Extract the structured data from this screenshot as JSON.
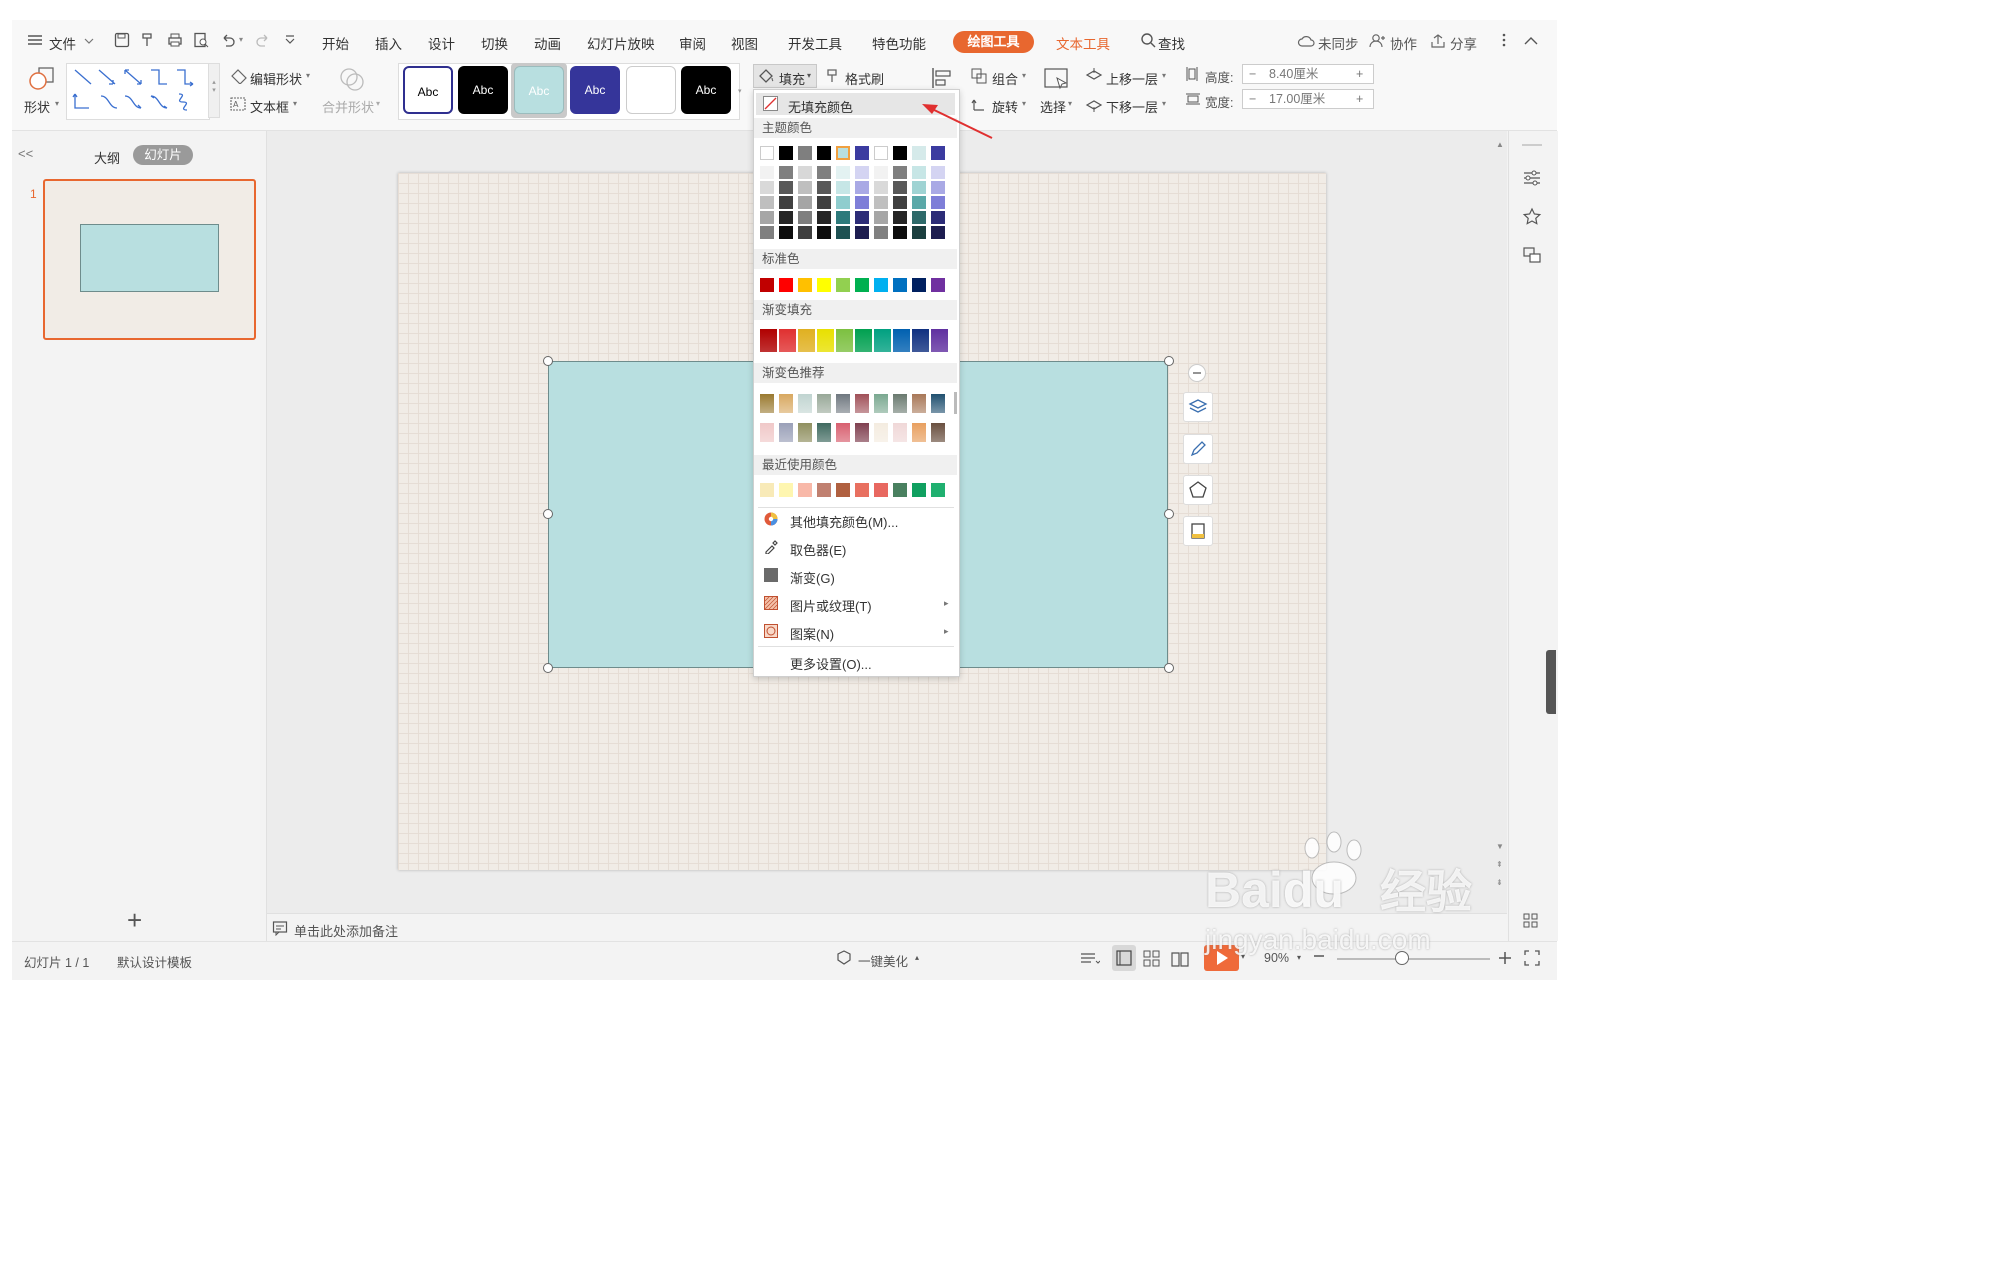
{
  "menubar": {
    "file_label": "文件",
    "tabs": [
      "开始",
      "插入",
      "设计",
      "切换",
      "动画",
      "幻灯片放映",
      "审阅",
      "视图",
      "开发工具",
      "特色功能"
    ],
    "drawing_tools": "绘图工具",
    "text_tools": "文本工具",
    "search": "查找",
    "unsynced": "未同步",
    "collaborate": "协作",
    "share": "分享"
  },
  "ribbon": {
    "shape_label": "形状",
    "edit_shape": "编辑形状",
    "textbox": "文本框",
    "merge_shape": "合并形状",
    "style_sample": "Abc",
    "fill": "填充",
    "format_painter": "格式刷",
    "group": "组合",
    "rotate": "旋转",
    "select": "选择",
    "bring_forward": "上移一层",
    "send_backward": "下移一层",
    "height_label": "高度:",
    "height_value": "8.40厘米",
    "width_label": "宽度:",
    "width_value": "17.00厘米",
    "minus": "−",
    "plus": "+"
  },
  "left_panel": {
    "collapse": "<<",
    "outline_tab": "大纲",
    "slides_tab": "幻灯片",
    "slide_number": "1",
    "add_slide": "+"
  },
  "fill_menu": {
    "no_fill": "无填充颜色",
    "theme_colors": "主题颜色",
    "standard_colors": "标准色",
    "gradient_fill": "渐变填充",
    "gradient_recommend": "渐变色推荐",
    "recent_colors": "最近使用颜色",
    "more_fill_colors": "其他填充颜色(M)...",
    "eyedropper": "取色器(E)",
    "gradient": "渐变(G)",
    "picture_texture": "图片或纹理(T)",
    "pattern": "图案(N)",
    "more_settings": "更多设置(O)...",
    "theme_top_row": [
      "#ffffff",
      "#000000",
      "#7f7f7f",
      "#000000",
      "#b8dfe0",
      "#3b3ba0",
      "#ffffff",
      "#000000",
      "#d5eaea",
      "#3b3ba0"
    ],
    "theme_shade_cols": [
      [
        "#f2f2f2",
        "#d9d9d9",
        "#bfbfbf",
        "#a6a6a6",
        "#808080"
      ],
      [
        "#7f7f7f",
        "#595959",
        "#404040",
        "#262626",
        "#0d0d0d"
      ],
      [
        "#d8d8d8",
        "#bfbfbf",
        "#a5a5a5",
        "#7f7f7f",
        "#3f3f3f"
      ],
      [
        "#7f7f7f",
        "#595959",
        "#404040",
        "#262626",
        "#0d0d0d"
      ],
      [
        "#e3f2f2",
        "#c6e6e6",
        "#8fcdce",
        "#2d7a7b",
        "#1e5152"
      ],
      [
        "#d4d4f2",
        "#a9a9e5",
        "#7e7ed8",
        "#2c2c78",
        "#1d1d50"
      ],
      [
        "#f2f2f2",
        "#d9d9d9",
        "#bfbfbf",
        "#a6a6a6",
        "#808080"
      ],
      [
        "#7f7f7f",
        "#595959",
        "#404040",
        "#262626",
        "#0d0d0d"
      ],
      [
        "#c7e6e6",
        "#9fd3d3",
        "#5aa8a8",
        "#2e6a6a",
        "#1b3f3f"
      ],
      [
        "#d4d4f2",
        "#a9a9e5",
        "#7e7ed8",
        "#2c2c78",
        "#1d1d50"
      ]
    ],
    "standard": [
      "#c00000",
      "#ff0000",
      "#ffc000",
      "#ffff00",
      "#92d050",
      "#00b050",
      "#00b0f0",
      "#0070c0",
      "#002060",
      "#7030a0"
    ],
    "gradients": [
      "#b00000",
      "#e03030",
      "#e0b020",
      "#e8e000",
      "#7cc040",
      "#00a050",
      "#00a080",
      "#0060b0",
      "#103080",
      "#6030a0"
    ],
    "recommend_row1": [
      "#9a7a30",
      "#d8a860",
      "#c0d4d0",
      "#98a898",
      "#707880",
      "#a05058",
      "#7aa890",
      "#6a7a70",
      "#a87858",
      "#205070"
    ],
    "recommend_row2": [
      "#f0c8c8",
      "#9aa0b8",
      "#909060",
      "#406a60",
      "#d86070",
      "#804050",
      "#f4ece0",
      "#f0d8d8",
      "#e8a060",
      "#6a5040"
    ],
    "recent": [
      "#f8eab8",
      "#fef6b0",
      "#f8b8a8",
      "#c08070",
      "#b06040",
      "#e87060",
      "#e86860",
      "#4a8060",
      "#10a060",
      "#20b070"
    ]
  },
  "notes_placeholder": "单击此处添加备注",
  "status": {
    "slide_info": "幻灯片 1 / 1",
    "template": "默认设计模板",
    "beautify": "一键美化",
    "zoom": "90%"
  },
  "watermark": {
    "brand": "Bai",
    "brand2": "du",
    "cn": "经验",
    "url": "jingyan.baidu.com"
  }
}
